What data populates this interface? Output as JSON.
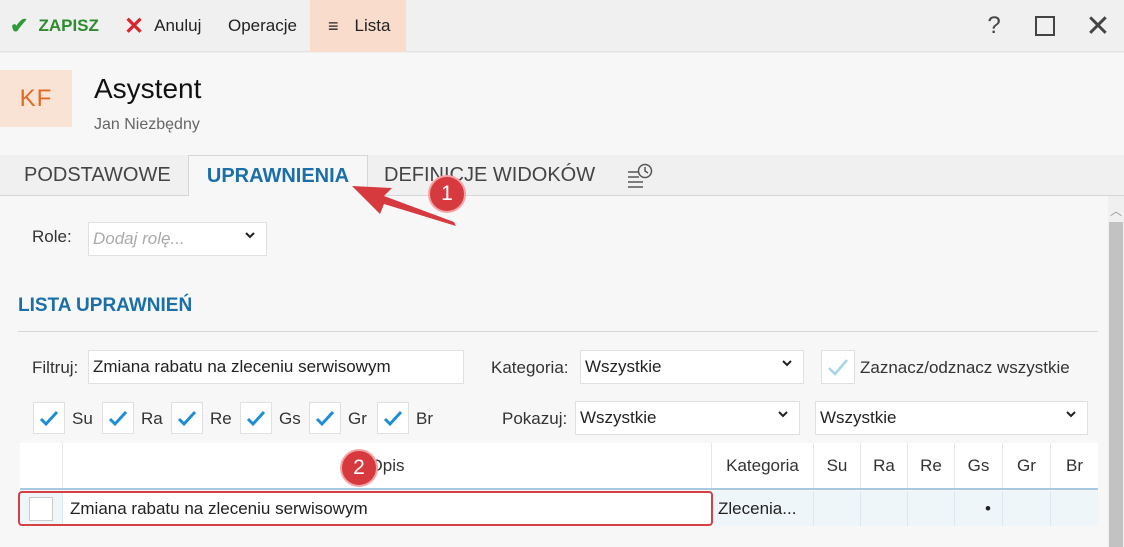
{
  "toolbar": {
    "save_label": "ZAPISZ",
    "cancel_label": "Anuluj",
    "operations_label": "Operacje",
    "list_label": "Lista",
    "help_label": "?"
  },
  "header": {
    "avatar_initials": "KF",
    "title": "Asystent",
    "subtitle": "Jan Niezbędny"
  },
  "tabs": [
    {
      "label": "PODSTAWOWE",
      "active": false
    },
    {
      "label": "UPRAWNIENIA",
      "active": true
    },
    {
      "label": "DEFINICJE WIDOKÓW",
      "active": false
    }
  ],
  "roles": {
    "label": "Role:",
    "placeholder": "Dodaj rolę..."
  },
  "section": {
    "title": "LISTA UPRAWNIEŃ"
  },
  "filters": {
    "filter_label": "Filtruj:",
    "filter_value": "Zmiana rabatu na zleceniu serwisowym",
    "category_label": "Kategoria:",
    "category_value": "Wszystkie",
    "select_all_label": "Zaznacz/odznacz wszystkie",
    "show_label": "Pokazuj:",
    "show_value": "Wszystkie",
    "show_value2": "Wszystkie",
    "checkboxes": [
      {
        "label": "Su",
        "checked": true
      },
      {
        "label": "Ra",
        "checked": true
      },
      {
        "label": "Re",
        "checked": true
      },
      {
        "label": "Gs",
        "checked": true
      },
      {
        "label": "Gr",
        "checked": true
      },
      {
        "label": "Br",
        "checked": true
      }
    ]
  },
  "grid": {
    "columns": [
      "Opis",
      "Kategoria",
      "Su",
      "Ra",
      "Re",
      "Gs",
      "Gr",
      "Br"
    ],
    "rows": [
      {
        "checked": false,
        "opis": "Zmiana rabatu na zleceniu serwisowym",
        "kategoria": "Zlecenia...",
        "su": "",
        "ra": "",
        "re": "",
        "gs": "•",
        "gr": "",
        "br": ""
      }
    ]
  },
  "callouts": [
    "1",
    "2"
  ],
  "colors": {
    "accent_blue": "#1a6fa8",
    "save_green": "#2e8b2e",
    "cancel_red": "#d9262e",
    "list_bg": "#f9dccb",
    "callout_red": "#d63a3f"
  }
}
